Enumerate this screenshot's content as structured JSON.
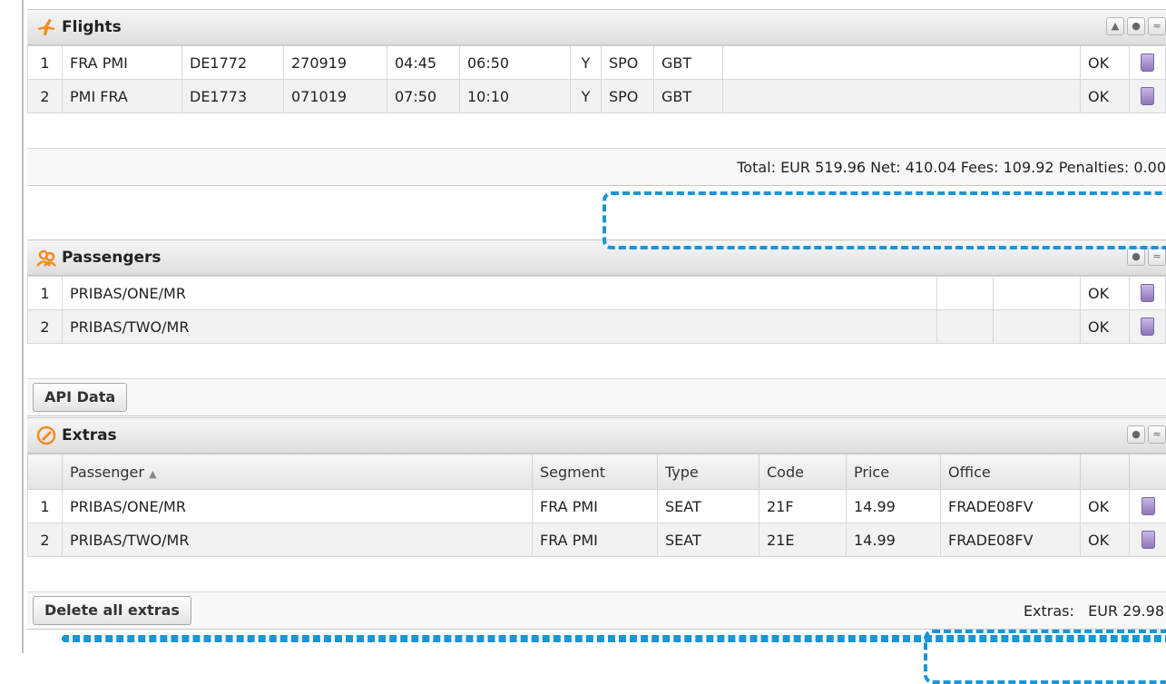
{
  "flights": {
    "title": "Flights",
    "icon": "flight-icon",
    "header_buttons": [
      "▲",
      "●",
      "≈"
    ],
    "rows": [
      {
        "n": "1",
        "route": "FRA PMI",
        "flight": "DE1772",
        "date": "270919",
        "dep": "04:45",
        "arr": "06:50",
        "cls": "Y",
        "code1": "SPO",
        "code2": "GBT",
        "status": "OK"
      },
      {
        "n": "2",
        "route": "PMI FRA",
        "flight": "DE1773",
        "date": "071019",
        "dep": "07:50",
        "arr": "10:10",
        "cls": "Y",
        "code1": "SPO",
        "code2": "GBT",
        "status": "OK"
      }
    ],
    "total": "Total: EUR 519.96 Net: 410.04 Fees: 109.92 Penalties: 0.00"
  },
  "passengers": {
    "title": "Passengers",
    "icon": "passengers-icon",
    "rows": [
      {
        "n": "1",
        "name": "PRIBAS/ONE/MR",
        "status": "OK"
      },
      {
        "n": "2",
        "name": "PRIBAS/TWO/MR",
        "status": "OK"
      }
    ],
    "api_button": "API Data"
  },
  "extras": {
    "title": "Extras",
    "icon": "extras-icon",
    "columns": {
      "passenger": "Passenger",
      "segment": "Segment",
      "type": "Type",
      "code": "Code",
      "price": "Price",
      "office": "Office"
    },
    "rows": [
      {
        "n": "1",
        "passenger": "PRIBAS/ONE/MR",
        "segment": "FRA PMI",
        "type": "SEAT",
        "code": "21F",
        "price": "14.99",
        "office": "FRADE08FV",
        "status": "OK"
      },
      {
        "n": "2",
        "passenger": "PRIBAS/TWO/MR",
        "segment": "FRA PMI",
        "type": "SEAT",
        "code": "21E",
        "price": "14.99",
        "office": "FRADE08FV",
        "status": "OK"
      }
    ],
    "delete_button": "Delete all extras",
    "extras_label": "Extras:",
    "extras_total": "EUR 29.98"
  },
  "colors": {
    "highlight": "#1a95d6",
    "trash": "#8f75b9",
    "icon": "#f28c1e"
  }
}
